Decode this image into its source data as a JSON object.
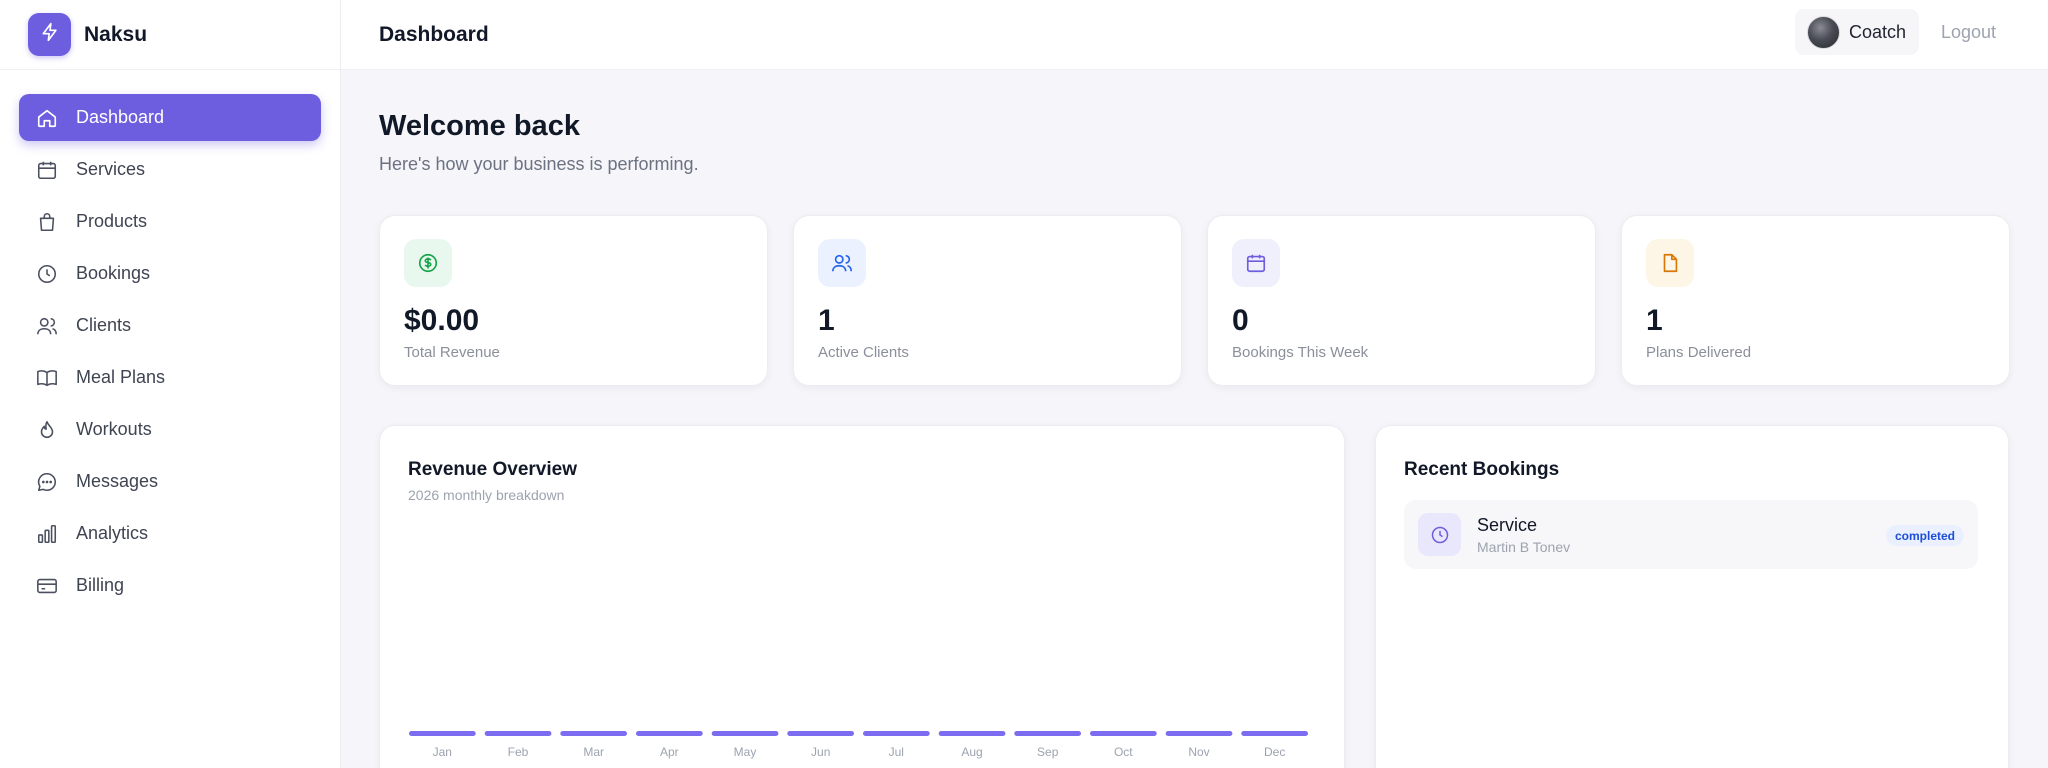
{
  "brand": {
    "name": "Naksu",
    "logo_icon": "bolt-icon",
    "accent": "#6d5ee0"
  },
  "sidebar": {
    "items": [
      {
        "label": "Dashboard",
        "icon": "home-icon",
        "active": true
      },
      {
        "label": "Services",
        "icon": "calendar-icon",
        "active": false
      },
      {
        "label": "Products",
        "icon": "shopping-bag-icon",
        "active": false
      },
      {
        "label": "Bookings",
        "icon": "clock-icon",
        "active": false
      },
      {
        "label": "Clients",
        "icon": "users-icon",
        "active": false
      },
      {
        "label": "Meal Plans",
        "icon": "book-icon",
        "active": false
      },
      {
        "label": "Workouts",
        "icon": "flame-icon",
        "active": false
      },
      {
        "label": "Messages",
        "icon": "message-icon",
        "active": false
      },
      {
        "label": "Analytics",
        "icon": "bar-chart-icon",
        "active": false
      },
      {
        "label": "Billing",
        "icon": "credit-card-icon",
        "active": false
      }
    ]
  },
  "header": {
    "title": "Dashboard",
    "user_name": "Coatch",
    "logout_label": "Logout"
  },
  "welcome": {
    "title": "Welcome back",
    "subtitle": "Here's how your business is performing."
  },
  "stats": [
    {
      "value": "$0.00",
      "label": "Total Revenue",
      "icon": "dollar-icon",
      "color": "#16a34a",
      "bg": "#e8f8ee"
    },
    {
      "value": "1",
      "label": "Active Clients",
      "icon": "users-icon",
      "color": "#2563eb",
      "bg": "#ebf1fe"
    },
    {
      "value": "0",
      "label": "Bookings This Week",
      "icon": "calendar-icon",
      "color": "#6d5ee0",
      "bg": "#f0effc"
    },
    {
      "value": "1",
      "label": "Plans Delivered",
      "icon": "document-icon",
      "color": "#d97706",
      "bg": "#fdf6e6"
    }
  ],
  "revenue": {
    "title": "Revenue Overview",
    "subtitle": "2026 monthly breakdown"
  },
  "chart_data": {
    "type": "bar",
    "categories": [
      "Jan",
      "Feb",
      "Mar",
      "Apr",
      "May",
      "Jun",
      "Jul",
      "Aug",
      "Sep",
      "Oct",
      "Nov",
      "Dec"
    ],
    "values": [
      0,
      0,
      0,
      0,
      0,
      0,
      0,
      0,
      0,
      0,
      0,
      0
    ],
    "title": "Revenue Overview",
    "subtitle": "2026 monthly breakdown",
    "bar_color": "#7b6cf0",
    "grid": false
  },
  "recent_bookings": {
    "title": "Recent Bookings",
    "items": [
      {
        "title": "Service",
        "client": "Martin B Tonev",
        "status": "completed",
        "icon": "clock-icon"
      }
    ]
  }
}
